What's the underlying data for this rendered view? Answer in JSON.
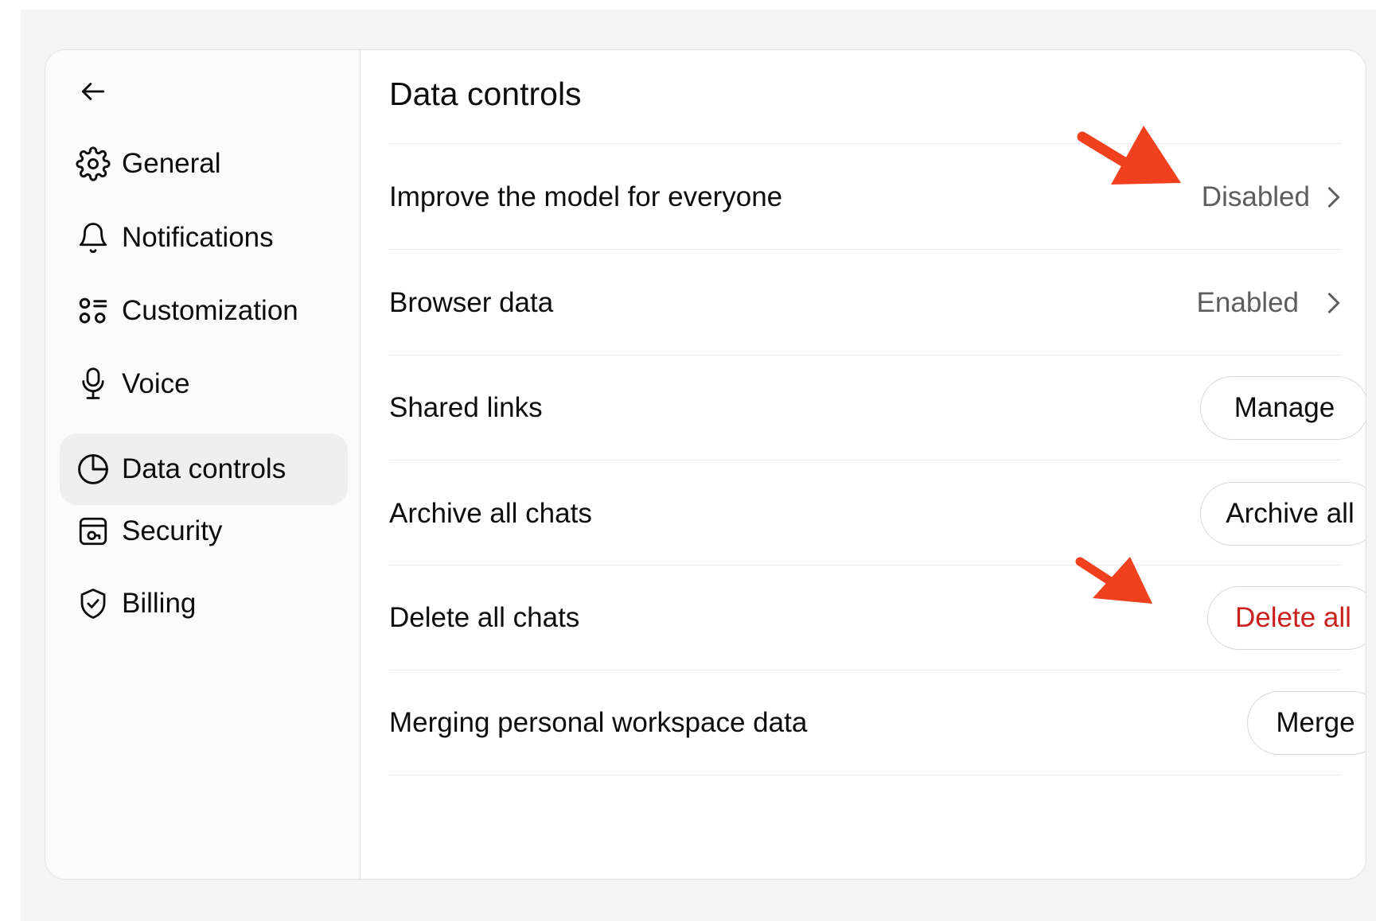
{
  "sidebar": {
    "back_icon": "arrow-left-icon",
    "items": [
      {
        "label": "General",
        "icon": "gear-icon",
        "active": false
      },
      {
        "label": "Notifications",
        "icon": "bell-icon",
        "active": false
      },
      {
        "label": "Customization",
        "icon": "customization-icon",
        "active": false
      },
      {
        "label": "Voice",
        "icon": "microphone-icon",
        "active": false
      },
      {
        "label": "Data controls",
        "icon": "pie-chart-icon",
        "active": true
      },
      {
        "label": "Security",
        "icon": "lock-card-icon",
        "active": false
      },
      {
        "label": "Billing",
        "icon": "shield-check-icon",
        "active": false
      }
    ]
  },
  "main": {
    "title": "Data controls",
    "rows": [
      {
        "label": "Improve the model for everyone",
        "value": "Disabled",
        "control": "chevron-link"
      },
      {
        "label": "Browser data",
        "value": "Enabled",
        "control": "chevron-link"
      },
      {
        "label": "Shared links",
        "button": "Manage",
        "control": "button"
      },
      {
        "label": "Archive all chats",
        "button": "Archive all",
        "control": "button"
      },
      {
        "label": "Delete all chats",
        "button": "Delete all",
        "control": "button-danger"
      },
      {
        "label": "Merging personal workspace data",
        "button": "Merge",
        "control": "button"
      }
    ]
  },
  "colors": {
    "danger_text": "#c9201d",
    "annotation_arrow": "#f0401e",
    "active_nav_bg": "#efefef",
    "backdrop": "#f5f5f5"
  },
  "annotations": [
    {
      "type": "arrow",
      "points_to": "Disabled"
    },
    {
      "type": "arrow",
      "points_to": "Delete all"
    }
  ]
}
